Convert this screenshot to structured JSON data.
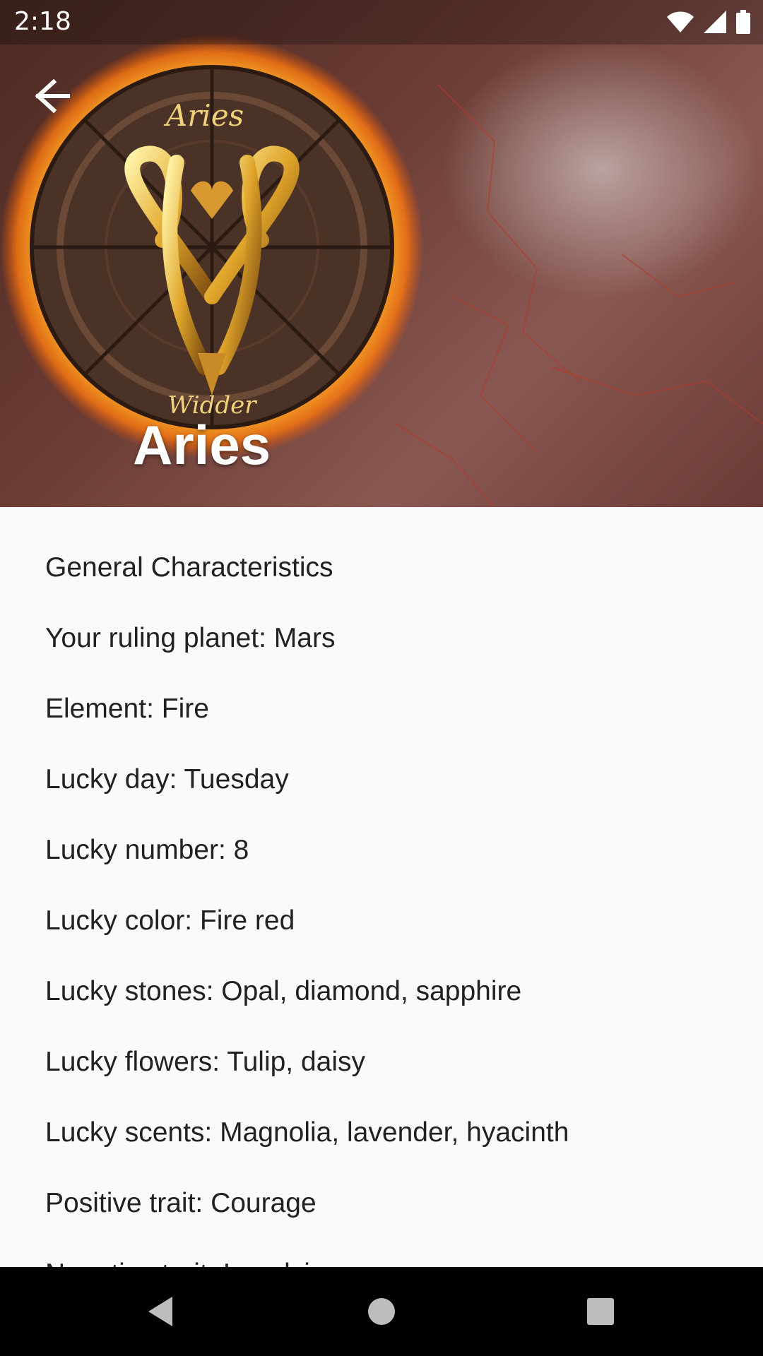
{
  "status_bar": {
    "time": "2:18"
  },
  "header": {
    "title": "Aries",
    "back_icon": "arrow-left-icon",
    "image_text": {
      "top": "Aries",
      "bottom": "Widder"
    }
  },
  "details": [
    "General Characteristics",
    "Your ruling planet: Mars",
    "Element: Fire",
    "Lucky day: Tuesday",
    "Lucky number: 8",
    "Lucky color: Fire red",
    "Lucky stones: Opal, diamond, sapphire",
    "Lucky flowers: Tulip, daisy",
    "Lucky scents: Magnolia, lavender, hyacinth",
    "Positive trait: Courage",
    "Negative trait: Impulsive"
  ],
  "nav": {
    "back_icon": "triangle-back-icon",
    "home_icon": "circle-home-icon",
    "recents_icon": "square-recents-icon"
  }
}
